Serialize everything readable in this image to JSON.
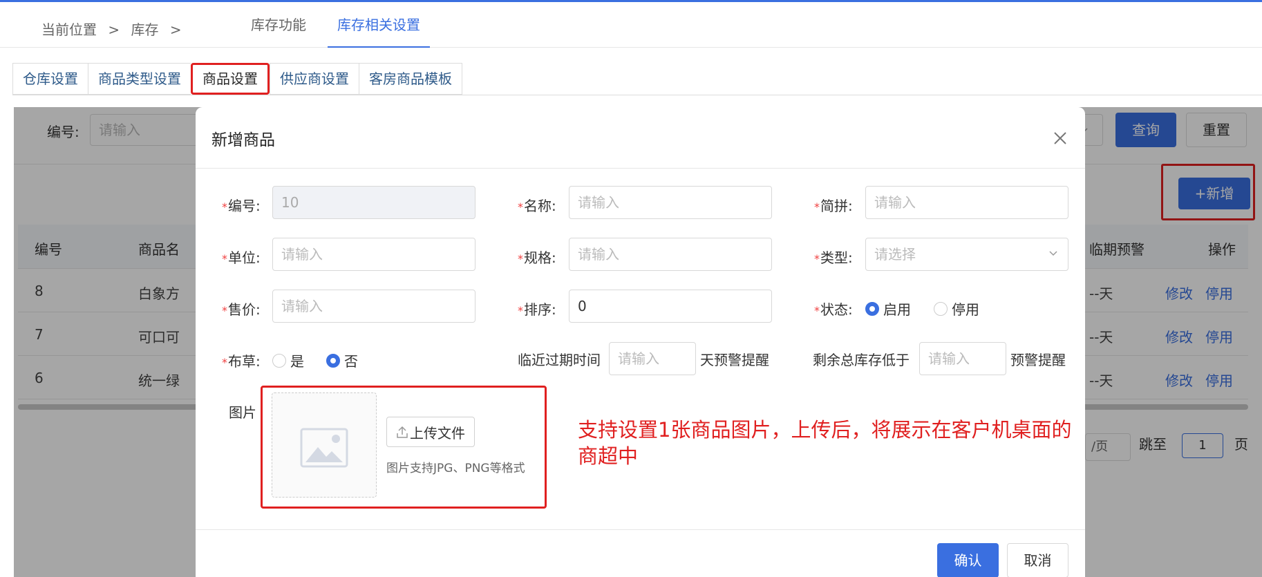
{
  "colors": {
    "accent": "#3a6fe0",
    "annotation": "#e02020",
    "required": "#f04040"
  },
  "header": {
    "breadcrumb": [
      "当前位置",
      ">",
      "库存",
      ">"
    ],
    "tabs": [
      "库存功能",
      "库存相关设置"
    ],
    "active_tab": "库存相关设置"
  },
  "subtabs": [
    "仓库设置",
    "商品类型设置",
    "商品设置",
    "供应商设置",
    "客房商品模板"
  ],
  "active_subtab": "商品设置",
  "background": {
    "filter_label": "编号:",
    "filter_placeholder": "请输入",
    "query_label": "查询",
    "reset_label": "重置",
    "add_label": "+新增",
    "columns": [
      "编号",
      "商品名",
      "临期预警",
      "操作"
    ],
    "rows": [
      {
        "id": "8",
        "name": "白象方",
        "expiry": "--天",
        "edit": "修改",
        "disable": "停用"
      },
      {
        "id": "7",
        "name": "可口可",
        "expiry": "--天",
        "edit": "修改",
        "disable": "停用"
      },
      {
        "id": "6",
        "name": "统一绿",
        "expiry": "--天",
        "edit": "修改",
        "disable": "停用"
      }
    ],
    "pager": {
      "page_size_suffix": "/页",
      "jump_label": "跳至",
      "jump_value": "1",
      "page_suffix": "页"
    }
  },
  "modal": {
    "title": "新增商品",
    "fields": {
      "code": {
        "label": "编号:",
        "value": "10"
      },
      "name": {
        "label": "名称:",
        "placeholder": "请输入"
      },
      "pinyin": {
        "label": "简拼:",
        "placeholder": "请输入"
      },
      "unit": {
        "label": "单位:",
        "placeholder": "请输入"
      },
      "spec": {
        "label": "规格:",
        "placeholder": "请输入"
      },
      "type": {
        "label": "类型:",
        "placeholder": "请选择"
      },
      "price": {
        "label": "售价:",
        "placeholder": "请输入"
      },
      "sort": {
        "label": "排序:",
        "value": "0"
      },
      "status": {
        "label": "状态:",
        "options": [
          "启用",
          "停用"
        ],
        "selected": "启用"
      },
      "linen": {
        "label": "布草:",
        "options": [
          "是",
          "否"
        ],
        "selected": "否"
      },
      "expiry": {
        "label": "临近过期时间",
        "placeholder": "请输入",
        "suffix": "天预警提醒"
      },
      "stock": {
        "label": "剩余总库存低于",
        "placeholder": "请输入",
        "suffix": "预警提醒"
      },
      "image": {
        "label": "图片",
        "upload_label": "上传文件",
        "hint": "图片支持JPG、PNG等格式"
      }
    },
    "annotation": "支持设置1张商品图片，上传后，将展示在客户机桌面的商超中",
    "confirm_label": "确认",
    "cancel_label": "取消"
  },
  "icons": [
    "close-icon",
    "chevron-down-icon",
    "upload-icon",
    "image-placeholder-icon"
  ]
}
